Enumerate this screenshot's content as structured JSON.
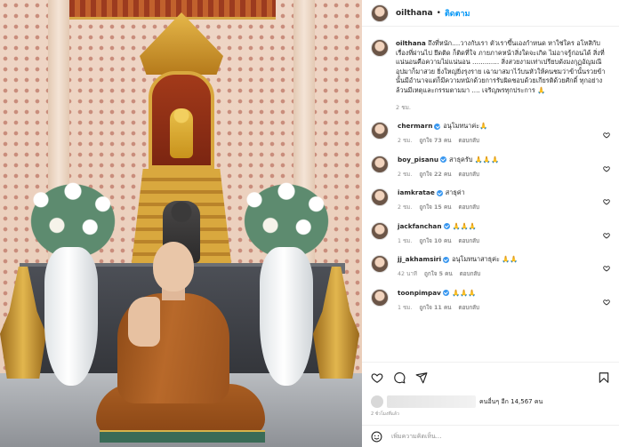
{
  "header": {
    "username": "oilthana",
    "separator": "•",
    "follow_label": "ติดตาม"
  },
  "caption": {
    "username": "oilthana",
    "text": "ถึงที่หนัก....วางกับเรา ตัวเราขึ้นเองกำหนด หาใช่ใคร อโหสิกับเรื่องที่ผ่านไป ยึดติด ก็ติดที่ใจ ภายภาคหน้าสิ่งใดจะเกิด ไม่อาจรู้ก่อนได้ สิ่งที่แน่นอนคือความไม่แน่นอน ............. สิ่งสวยงามเท่าเปรียบดังมงกุฏอัญมณี อุปมาก็มาสวย ยิ่งใหญ่ยิ่งรุงราย เฉามาสมาไว้บนหัวให้คนชมว่าข้านั้นรวยข้านั้นมีอำนาจแต่ก็มีความหนักด้วยการรับผิดชอบด้วยเกียรติด้วยศักดิ์ ทุกอย่างล้วนมีเหตุและกรรมตามมา .... เจริญพรทุกประการ 🙏",
    "time": "2 ชม."
  },
  "comments": [
    {
      "username": "chermarn",
      "verified": true,
      "text": "อนุโมทนาค่ะ🙏",
      "time": "2 ชม.",
      "likes": "ถูกใจ 73 คน",
      "reply": "ตอบกลับ"
    },
    {
      "username": "boy_pisanu",
      "verified": true,
      "text": "สาธุครับ 🙏🙏🙏",
      "time": "2 ชม.",
      "likes": "ถูกใจ 22 คน",
      "reply": "ตอบกลับ"
    },
    {
      "username": "iamkratae",
      "verified": true,
      "text": "สาธุค่า",
      "time": "2 ชม.",
      "likes": "ถูกใจ 15 คน",
      "reply": "ตอบกลับ"
    },
    {
      "username": "jackfanchan",
      "verified": true,
      "text": "🙏🙏🙏",
      "time": "1 ชม.",
      "likes": "ถูกใจ 10 คน",
      "reply": "ตอบกลับ"
    },
    {
      "username": "jj_akhamsiri",
      "verified": true,
      "text": "อนุโมทนาสาธุค่ะ 🙏🙏",
      "time": "42 นาที",
      "likes": "ถูกใจ 5 คน",
      "reply": "ตอบกลับ"
    },
    {
      "username": "toonpimpav",
      "verified": true,
      "text": "🙏🙏🙏",
      "time": "1 ชม.",
      "likes": "ถูกใจ 11 คน",
      "reply": "ตอบกลับ"
    }
  ],
  "actions": {
    "likes_suffix": "คนอื่นๆ อีก 14,567 คน",
    "post_time": "2 ชั่วโมงที่แล้ว",
    "add_comment_placeholder": "เพิ่มความคิดเห็น..."
  },
  "icons": {
    "like": "heart-icon",
    "comment": "comment-icon",
    "share": "share-icon",
    "save": "bookmark-icon",
    "emoji": "emoji-icon"
  },
  "colors": {
    "link_blue": "#0095f6",
    "verified_blue": "#3897f0",
    "muted": "#8e8e8e"
  }
}
